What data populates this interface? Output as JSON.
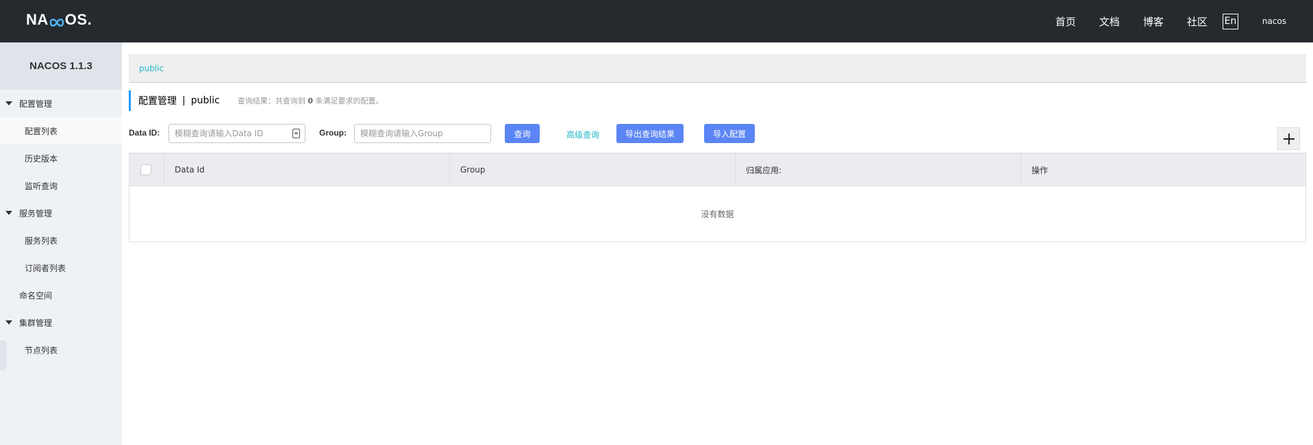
{
  "header": {
    "logo_text_a": "NA",
    "logo_text_b": "OS",
    "logo_dot": ".",
    "nav": [
      "首页",
      "文档",
      "博客",
      "社区"
    ],
    "lang": "En",
    "user": "nacos"
  },
  "sidebar": {
    "title": "NACOS 1.1.3",
    "groups": [
      {
        "label": "配置管理",
        "items": [
          "配置列表",
          "历史版本",
          "监听查询"
        ]
      },
      {
        "label": "服务管理",
        "items": [
          "服务列表",
          "订阅者列表"
        ]
      },
      {
        "plain": "命名空间"
      },
      {
        "label": "集群管理",
        "items": [
          "节点列表"
        ]
      }
    ]
  },
  "main": {
    "namespace_link": "public",
    "page_title": "配置管理",
    "page_sep": "|",
    "page_ns": "public",
    "result_prefix": "查询结果：共查询到",
    "result_count": "0",
    "result_suffix": "条满足要求的配置。",
    "filters": {
      "dataid_label": "Data ID:",
      "dataid_placeholder": "模糊查询请输入Data ID",
      "dataid_value": "",
      "group_label": "Group:",
      "group_placeholder": "模糊查询请输入Group",
      "group_value": "",
      "query_btn": "查询",
      "advanced_link": "高级查询",
      "export_btn": "导出查询结果",
      "import_btn": "导入配置"
    },
    "table": {
      "columns": [
        "Data Id",
        "Group",
        "归属应用:",
        "操作"
      ],
      "empty_text": "没有数据"
    }
  },
  "colors": {
    "header_bg": "#252a2f",
    "accent": "#23b7c8",
    "primary_btn": "#5b85f5",
    "sidebar_bg": "#eef1f5"
  }
}
